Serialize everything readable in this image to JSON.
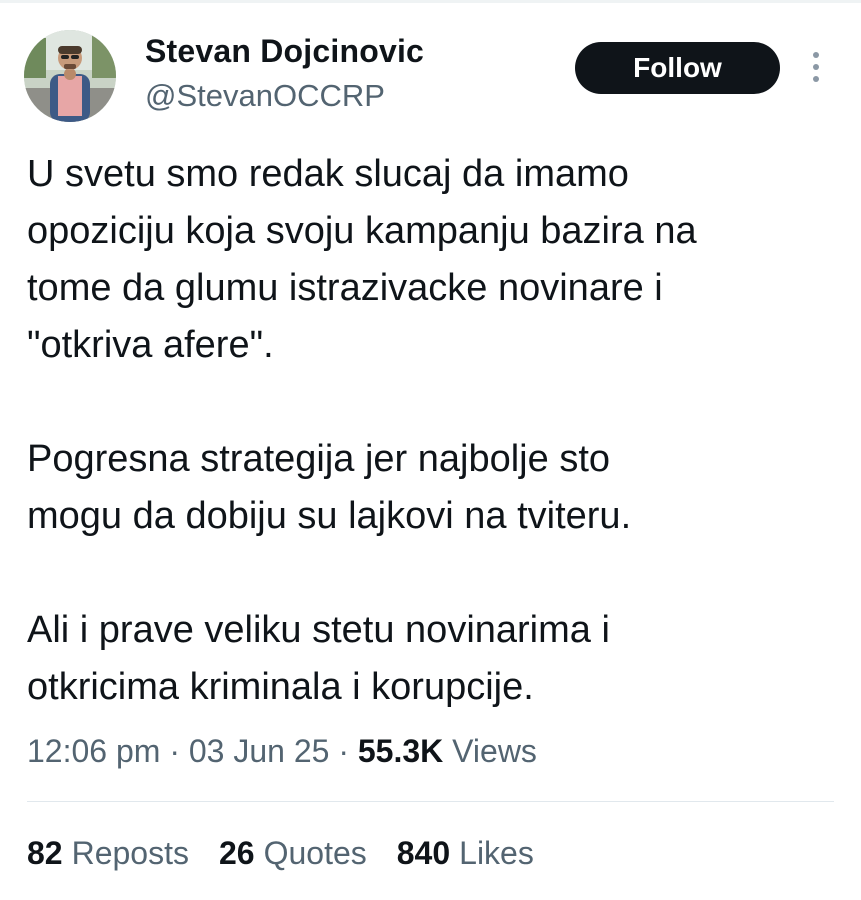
{
  "author": {
    "display_name": "Stevan Dojcinovic",
    "handle": "@StevanOCCRP"
  },
  "follow_button": {
    "label": "Follow"
  },
  "more_menu": {
    "icon": "more-vertical-icon"
  },
  "tweet": {
    "paragraphs": [
      [
        "U svetu smo redak slucaj da imamo",
        "opoziciju koja svoju kampanju bazira na",
        "tome da glumu istrazivacke novinare i",
        "\"otkriva afere\"."
      ],
      [
        "Pogresna strategija jer najbolje sto",
        "mogu da dobiju su lajkovi na tviteru."
      ],
      [
        "Ali i prave veliku stetu novinarima i",
        "otkricima kriminala i korupcije."
      ]
    ]
  },
  "meta": {
    "time": "12:06 pm",
    "separator": "·",
    "date": "03 Jun 25",
    "views_count": "55.3K",
    "views_label": "Views"
  },
  "stats": {
    "reposts_count": "82",
    "reposts_label": "Reposts",
    "quotes_count": "26",
    "quotes_label": "Quotes",
    "likes_count": "840",
    "likes_label": "Likes"
  },
  "colors": {
    "text_primary": "#0f1419",
    "text_secondary": "#536471",
    "follow_bg": "#0f1419",
    "follow_text": "#ffffff",
    "divider": "#e1e8ed"
  }
}
